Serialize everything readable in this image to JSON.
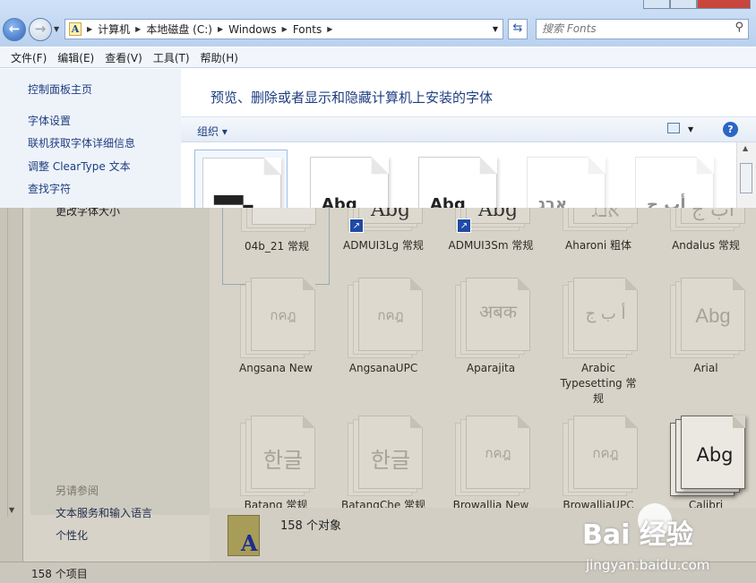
{
  "address": {
    "crumbs": [
      "计算机",
      "本地磁盘 (C:)",
      "Windows",
      "Fonts"
    ],
    "search_placeholder": "搜索 Fonts"
  },
  "menu": [
    "文件(F)",
    "编辑(E)",
    "查看(V)",
    "工具(T)",
    "帮助(H)"
  ],
  "sidebar": {
    "items": [
      "控制面板主页",
      "字体设置",
      "联机获取字体详细信息",
      "调整 ClearType 文本",
      "查找字符"
    ],
    "cut_item": "更改字体大小",
    "see_also": "另请参阅",
    "links": [
      "文本服务和输入语言",
      "个性化"
    ]
  },
  "content": {
    "title": "预览、删除或者显示和隐藏计算机上安装的字体",
    "organize": "组织 ▾"
  },
  "fonts": [
    {
      "name": "04b_21 常规",
      "glyph": "",
      "selected": true,
      "shortcut": false
    },
    {
      "name": "ADMUI3Lg 常规",
      "glyph": "Abg",
      "shortcut": true
    },
    {
      "name": "ADMUI3Sm 常规",
      "glyph": "Abg",
      "shortcut": true
    },
    {
      "name": "Aharoni 粗体",
      "glyph": "אבג",
      "shortcut": false
    },
    {
      "name": "Andalus 常规",
      "glyph": "أب ج",
      "shortcut": false
    },
    {
      "name": "Angsana New",
      "glyph": "กคฎ"
    },
    {
      "name": "AngsanaUPC",
      "glyph": "กคฎ"
    },
    {
      "name": "Aparajita",
      "glyph": "अबक"
    },
    {
      "name": "Arabic Typesetting 常规",
      "glyph": "أ ب ج"
    },
    {
      "name": "Arial",
      "glyph": "Abg"
    },
    {
      "name": "Batang 常规",
      "glyph": "한글"
    },
    {
      "name": "BatangChe 常规",
      "glyph": "한글"
    },
    {
      "name": "Browallia New",
      "glyph": "กคฎ"
    },
    {
      "name": "BrowalliaUPC",
      "glyph": "กคฎ"
    },
    {
      "name": "Calibri",
      "glyph": "Abg",
      "bright": true
    }
  ],
  "details": {
    "count": "158 个对象",
    "icon_letter": "A"
  },
  "status": {
    "text": "158 个项目"
  },
  "watermark": {
    "logo": "Bai 经验",
    "url": "jingyan.baidu.com"
  }
}
